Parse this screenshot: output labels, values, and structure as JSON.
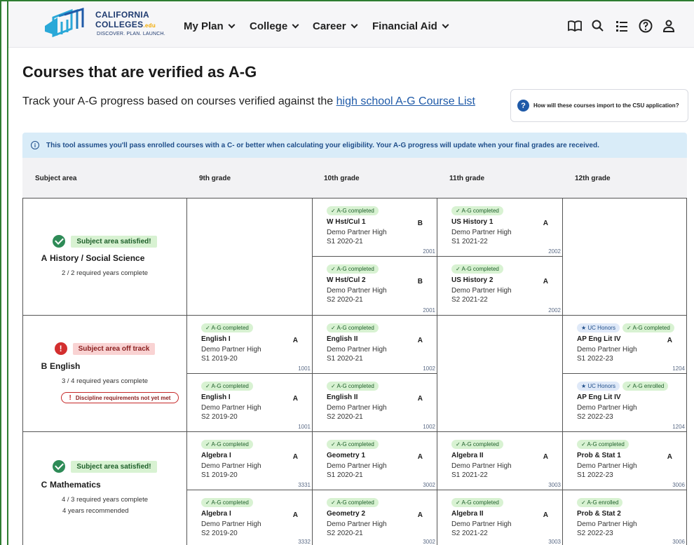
{
  "nav": {
    "logo_line1": "CALIFORNIA",
    "logo_line2": "COLLEGES",
    "logo_edu": ".edu",
    "logo_tagline": "DISCOVER. PLAN. LAUNCH.",
    "menus": [
      "My Plan",
      "College",
      "Career",
      "Financial Aid"
    ],
    "icons": [
      "book-icon",
      "search-icon",
      "list-icon",
      "help-icon",
      "user-icon"
    ]
  },
  "page": {
    "title": "Courses that are verified as A-G",
    "subtitle_prefix": "Track your A-G progress based on courses verified against the ",
    "subtitle_link": "high school A-G Course List",
    "help_q": "?",
    "help_text": "How will these courses import to the CSU application?",
    "banner_icon": "i",
    "banner_text": "This tool assumes you'll pass enrolled courses with a C- or better when calculating your eligibility. Your A-G progress will update when your final grades are received."
  },
  "table": {
    "headers": [
      "Subject area",
      "9th grade",
      "10th grade",
      "11th grade",
      "12th grade"
    ]
  },
  "subjects": [
    {
      "letter": "A",
      "name": "History / Social Science",
      "status": "Subject area satisfied!",
      "status_type": "ok",
      "required": "2 / 2 required years complete",
      "recommended": "",
      "discipline": ""
    },
    {
      "letter": "B",
      "name": "English",
      "status": "Subject area off track",
      "status_type": "bad",
      "status_icon": "!",
      "required": "3 / 4 required years complete",
      "recommended": "",
      "discipline": "Discipline requirements not yet met",
      "discipline_icon": "!"
    },
    {
      "letter": "C",
      "name": "Mathematics",
      "status": "Subject area satisfied!",
      "status_type": "ok",
      "required": "4 / 3 required years complete",
      "recommended": "4 years recommended",
      "discipline": ""
    }
  ],
  "courses": {
    "A": {
      "g10": [
        {
          "badges": [
            "✓ A-G completed"
          ],
          "honors": "",
          "name": "W Hst/Cul 1",
          "grade": "B",
          "school": "Demo Partner High",
          "term": "S1 2020-21",
          "code": "2001"
        },
        {
          "badges": [
            "✓ A-G completed"
          ],
          "honors": "",
          "name": "W Hst/Cul 2",
          "grade": "B",
          "school": "Demo Partner High",
          "term": "S2 2020-21",
          "code": "2001"
        }
      ],
      "g11": [
        {
          "badges": [
            "✓ A-G completed"
          ],
          "honors": "",
          "name": "US History 1",
          "grade": "A",
          "school": "Demo Partner High",
          "term": "S1 2021-22",
          "code": "2002"
        },
        {
          "badges": [
            "✓ A-G completed"
          ],
          "honors": "",
          "name": "US History 2",
          "grade": "A",
          "school": "Demo Partner High",
          "term": "S2 2021-22",
          "code": "2002"
        }
      ]
    },
    "B": {
      "g9": [
        {
          "badges": [
            "✓ A-G completed"
          ],
          "honors": "",
          "name": "English I",
          "grade": "A",
          "school": "Demo Partner High",
          "term": "S1 2019-20",
          "code": "1001"
        },
        {
          "badges": [
            "✓ A-G completed"
          ],
          "honors": "",
          "name": "English I",
          "grade": "A",
          "school": "Demo Partner High",
          "term": "S2 2019-20",
          "code": "1001"
        }
      ],
      "g10": [
        {
          "badges": [
            "✓ A-G completed"
          ],
          "honors": "",
          "name": "English II",
          "grade": "A",
          "school": "Demo Partner High",
          "term": "S1 2020-21",
          "code": "1002"
        },
        {
          "badges": [
            "✓ A-G completed"
          ],
          "honors": "",
          "name": "English II",
          "grade": "A",
          "school": "Demo Partner High",
          "term": "S2 2020-21",
          "code": "1002"
        }
      ],
      "g12": [
        {
          "badges": [
            "✓ A-G completed"
          ],
          "honors": "★ UC Honors",
          "name": "AP Eng Lit IV",
          "grade": "A",
          "school": "Demo Partner High",
          "term": "S1 2022-23",
          "code": "1204"
        },
        {
          "badges": [
            "✓ A-G enrolled"
          ],
          "honors": "★ UC Honors",
          "name": "AP Eng Lit IV",
          "grade": "",
          "school": "Demo Partner High",
          "term": "S2 2022-23",
          "code": "1204"
        }
      ]
    },
    "C": {
      "g9": [
        {
          "badges": [
            "✓ A-G completed"
          ],
          "honors": "",
          "name": "Algebra I",
          "grade": "A",
          "school": "Demo Partner High",
          "term": "S1 2019-20",
          "code": "3331"
        },
        {
          "badges": [
            "✓ A-G completed"
          ],
          "honors": "",
          "name": "Algebra I",
          "grade": "A",
          "school": "Demo Partner High",
          "term": "S2 2019-20",
          "code": "3332"
        }
      ],
      "g10": [
        {
          "badges": [
            "✓ A-G completed"
          ],
          "honors": "",
          "name": "Geometry 1",
          "grade": "A",
          "school": "Demo Partner High",
          "term": "S1 2020-21",
          "code": "3002"
        },
        {
          "badges": [
            "✓ A-G completed"
          ],
          "honors": "",
          "name": "Geometry 2",
          "grade": "A",
          "school": "Demo Partner High",
          "term": "S2 2020-21",
          "code": "3002"
        }
      ],
      "g11": [
        {
          "badges": [
            "✓ A-G completed"
          ],
          "honors": "",
          "name": "Algebra II",
          "grade": "A",
          "school": "Demo Partner High",
          "term": "S1 2021-22",
          "code": "3003"
        },
        {
          "badges": [
            "✓ A-G completed"
          ],
          "honors": "",
          "name": "Algebra II",
          "grade": "A",
          "school": "Demo Partner High",
          "term": "S2 2021-22",
          "code": "3003"
        }
      ],
      "g12": [
        {
          "badges": [
            "✓ A-G completed"
          ],
          "honors": "",
          "name": "Prob & Stat 1",
          "grade": "A",
          "school": "Demo Partner High",
          "term": "S1 2022-23",
          "code": "3006"
        },
        {
          "badges": [
            "✓ A-G enrolled"
          ],
          "honors": "",
          "name": "Prob & Stat 2",
          "grade": "",
          "school": "Demo Partner High",
          "term": "S2 2022-23",
          "code": "3006"
        }
      ]
    }
  },
  "colors": {
    "brand": "#1f3b70",
    "accent": "#1f5aa8",
    "ok": "#2e8b57",
    "bad": "#d32f2f",
    "frame": "#2e7d32"
  }
}
